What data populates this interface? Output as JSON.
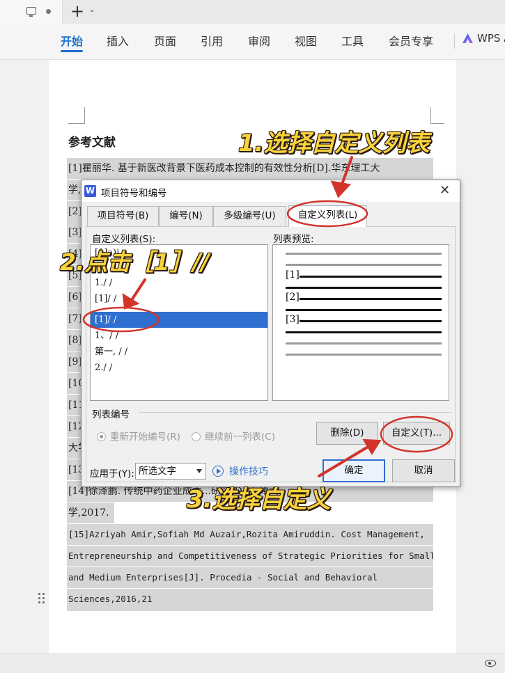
{
  "tabstrip": {
    "plus": "+",
    "caret": "⌄"
  },
  "ribbon": {
    "items": [
      "开始",
      "插入",
      "页面",
      "引用",
      "审阅",
      "视图",
      "工具",
      "会员专享"
    ],
    "wps_ai": "WPS AI"
  },
  "document": {
    "heading": "参考文献",
    "refs": [
      "[1]瞿丽华. 基于新医改背景下医药成本控制的有效性分析[D].华东理工大",
      "学,",
      "[2]",
      "[3]",
      "[4]",
      "[5]",
      "[6]",
      "[7]",
      "[8]",
      "[9]",
      "[10",
      "[11",
      "[12",
      "大学",
      "[13",
      "[14]徐泽鹏. 传统中药企业成本...研究[D].天津大",
      "学,2017.",
      "[15]Azriyah Amir,Sofiah Md Auzair,Rozita Amiruddin. Cost Management,",
      "Entrepreneurship and Competitiveness of Strategic Priorities for Small",
      "and  Medium  Enterprises[J].  Procedia  -  Social  and  Behavioral",
      "Sciences,2016,21"
    ]
  },
  "dialog": {
    "title": "项目符号和编号",
    "close": "✕",
    "tabs": [
      "项目符号(B)",
      "编号(N)",
      "多级编号(U)",
      "自定义列表(L)"
    ],
    "list_label": "自定义列表(S):",
    "preview_label": "列表预览:",
    "list_items": [
      "[1]a)i.",
      "1./ /",
      "[1]/ /",
      "[1]/ /",
      "1、/ /",
      "第一, / /",
      "2./ /"
    ],
    "selected_index": 3,
    "preview_tags": [
      "[1]",
      "[2]",
      "[3]"
    ],
    "group_label": "列表编号",
    "radio_restart": "重新开始编号(R)",
    "radio_continue": "继续前一列表(C)",
    "delete_button": "删除(D)",
    "custom_button": "自定义(T)...",
    "apply_label": "应用于(Y):",
    "apply_value": "所选文字",
    "tips": "操作技巧",
    "ok_button": "确定",
    "cancel_button": "取消"
  },
  "annotations": {
    "step1": "1.选择自定义列表",
    "step2": "2.点击［1］//",
    "step3": "3.选择自定义",
    "color": "#f6d23c",
    "arrow_color": "#d2342c"
  }
}
